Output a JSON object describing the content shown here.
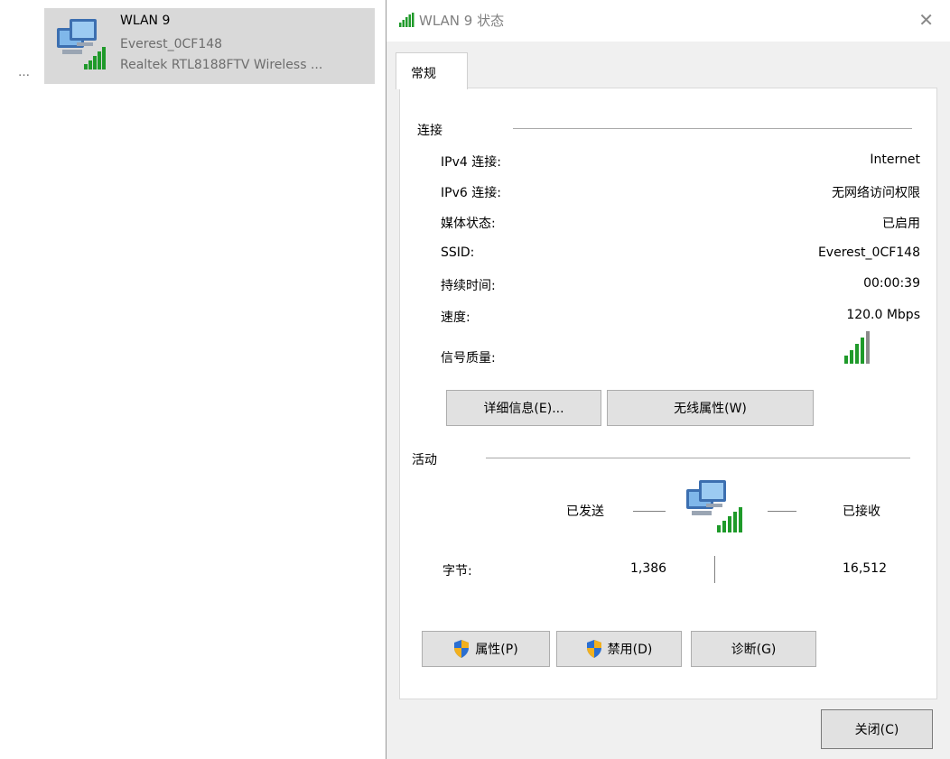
{
  "left_panel": {
    "ellipsis": "…",
    "adapter": {
      "name": "WLAN 9",
      "ssid": "Everest_0CF148",
      "driver": "Realtek RTL8188FTV Wireless ..."
    },
    "icon": "network-computers-icon"
  },
  "dialog": {
    "title": "WLAN 9 状态",
    "close": "✕",
    "tab": "常规",
    "connection": {
      "group_label": "连接",
      "rows": [
        {
          "label": "IPv4 连接:",
          "value": "Internet"
        },
        {
          "label": "IPv6 连接:",
          "value": "无网络访问权限"
        },
        {
          "label": "媒体状态:",
          "value": "已启用"
        },
        {
          "label": "SSID:",
          "value": "Everest_0CF148"
        },
        {
          "label": "持续时间:",
          "value": "00:00:39"
        },
        {
          "label": "速度:",
          "value": "120.0 Mbps"
        }
      ],
      "signal_label": "信号质量:",
      "signal_bars_lit": 4,
      "signal_bars_total": 5,
      "details_button": "详细信息(E)...",
      "wireless_button": "无线属性(W)"
    },
    "activity": {
      "group_label": "活动",
      "sent_label": "已发送",
      "received_label": "已接收",
      "bytes_label": "字节:",
      "bytes_sent": "1,386",
      "bytes_received": "16,512"
    },
    "buttons": {
      "properties": "属性(P)",
      "disable": "禁用(D)",
      "diagnose": "诊断(G)",
      "close": "关闭(C)"
    },
    "colors": {
      "signal_green": "#1f9a2a",
      "signal_gray": "#8a8a8a",
      "shield_blue": "#2b6fd1",
      "shield_gold": "#f2b01e"
    }
  }
}
